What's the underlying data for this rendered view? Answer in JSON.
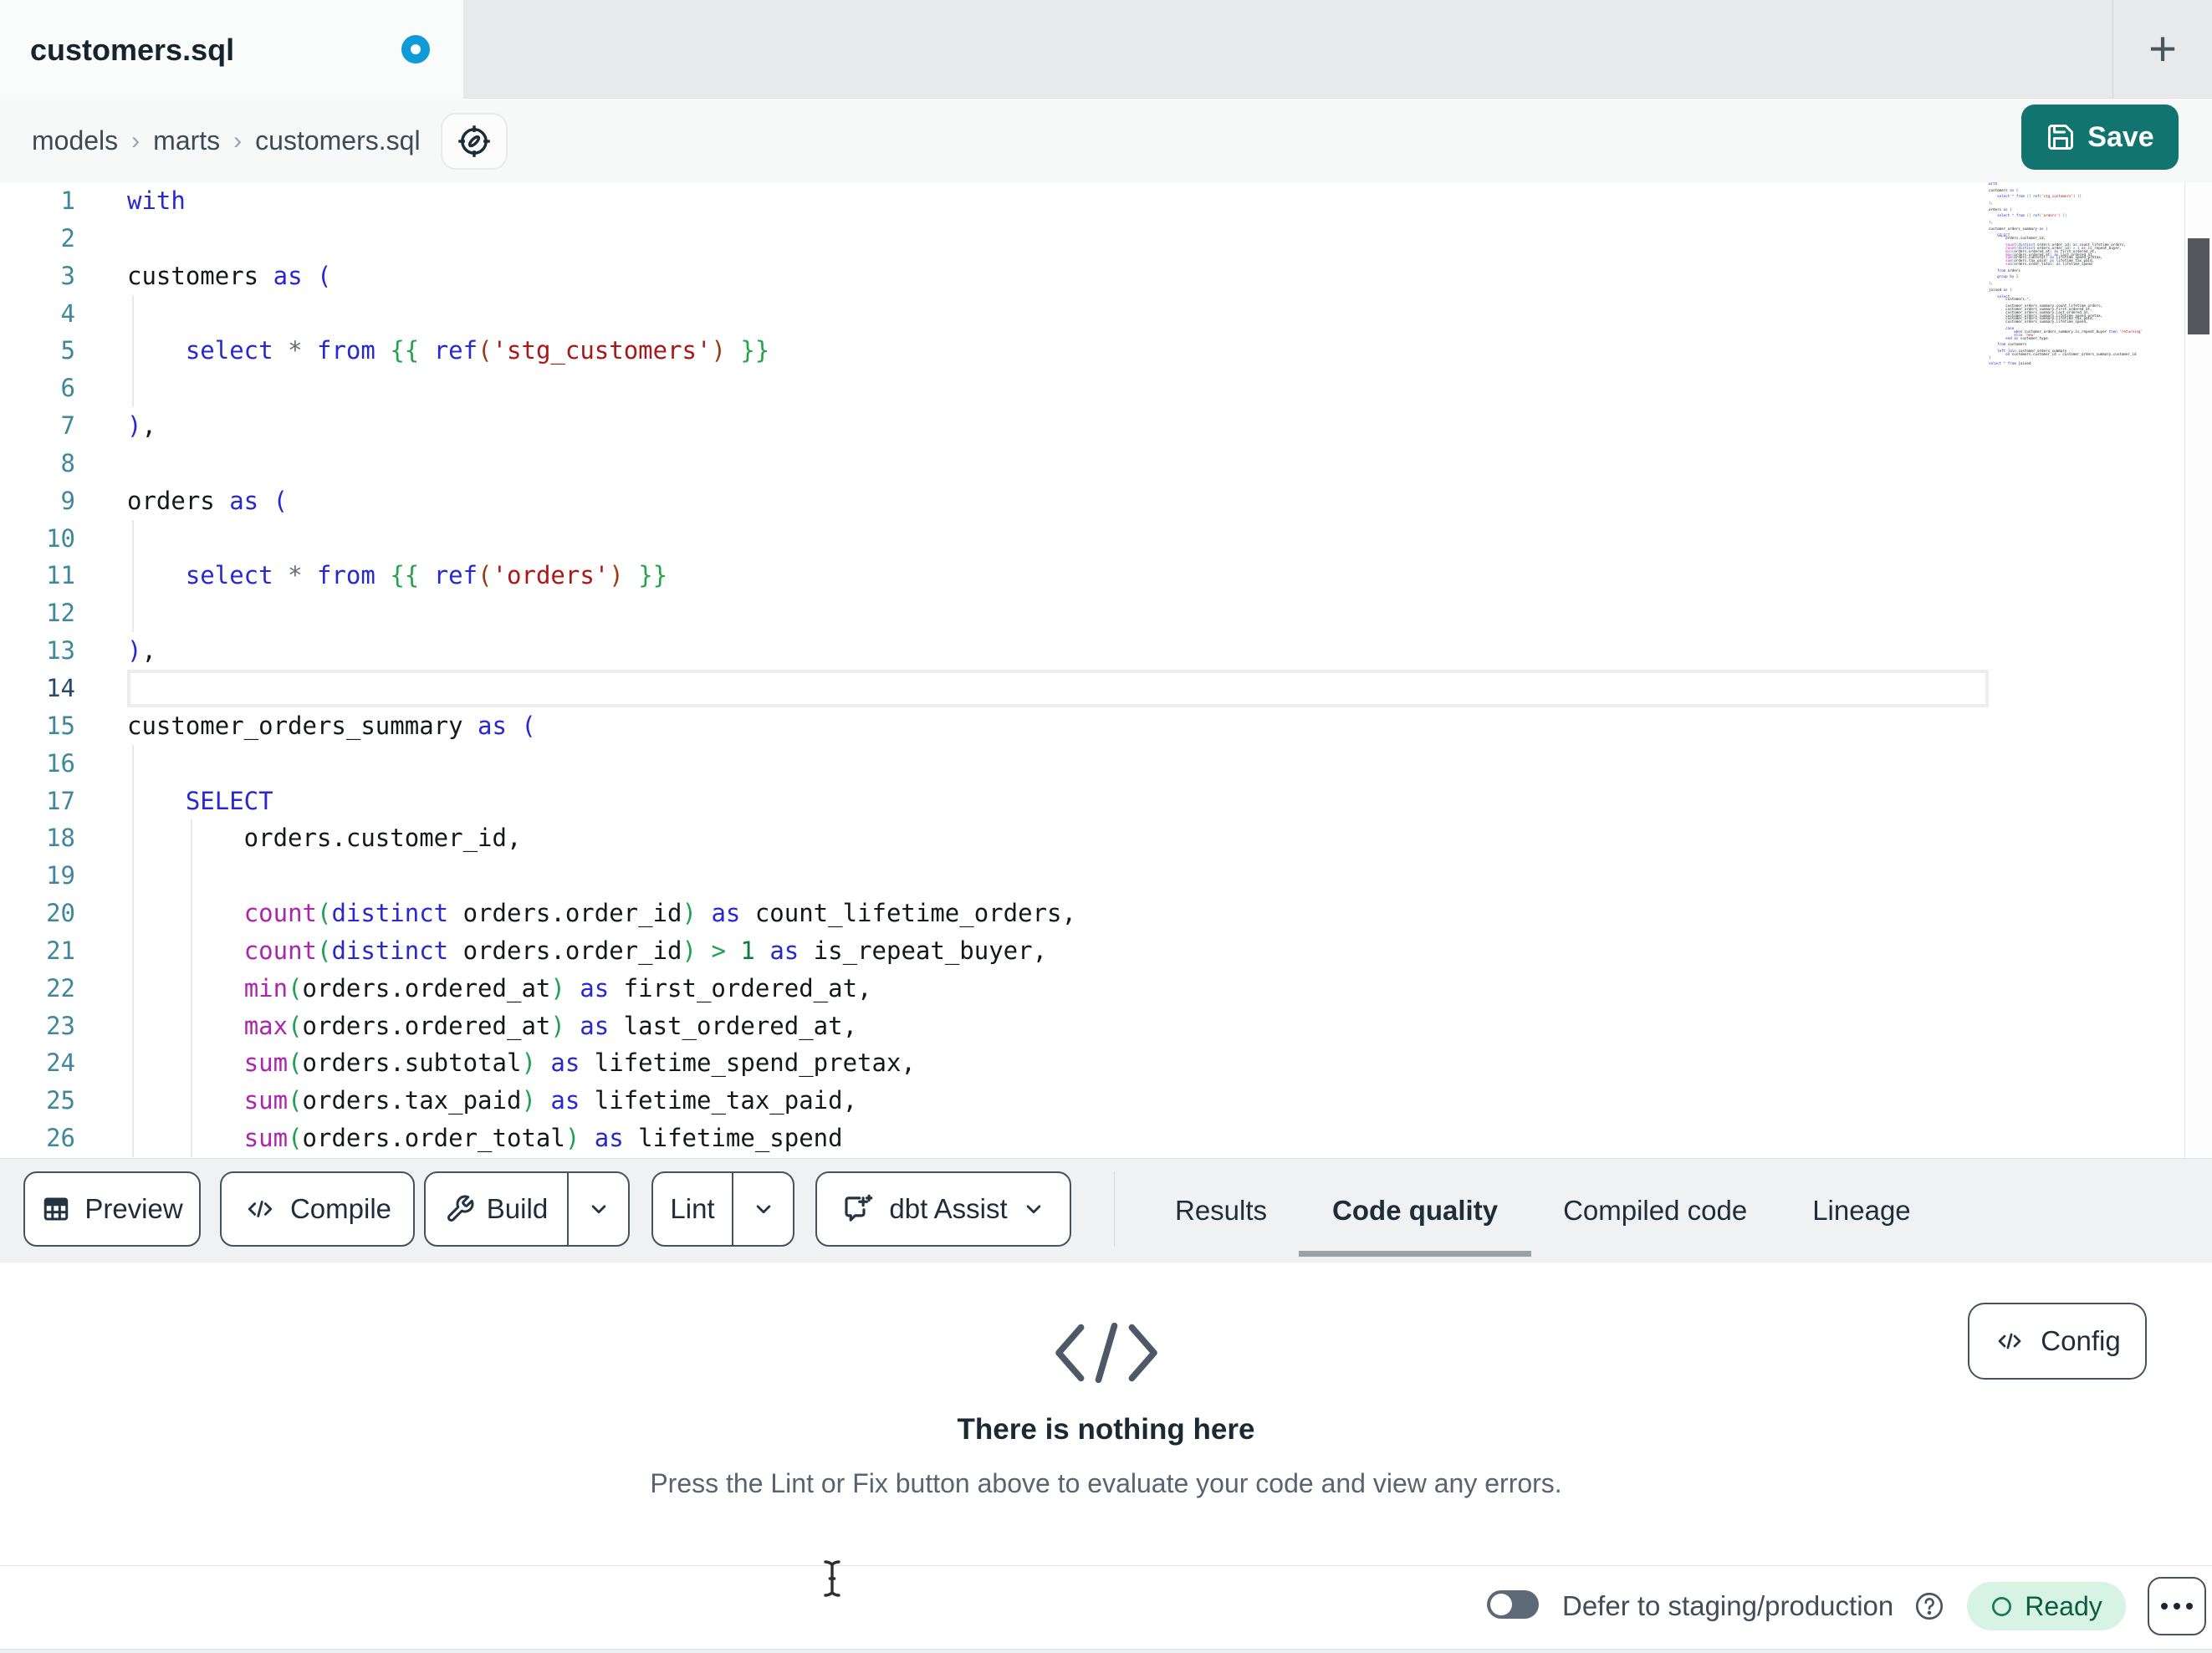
{
  "tab_bar": {
    "title": "customers.sql",
    "unsaved": true,
    "new_tab_glyph": "+"
  },
  "breadcrumb": {
    "items": [
      "models",
      "marts",
      "customers.sql"
    ],
    "separator": "›"
  },
  "save": {
    "label": "Save"
  },
  "toolbar": {
    "preview_label": "Preview",
    "compile_label": "Compile",
    "build_label": "Build",
    "lint_label": "Lint",
    "assist_label": "dbt Assist"
  },
  "panel_tabs": [
    {
      "label": "Results",
      "active": false
    },
    {
      "label": "Code quality",
      "active": true
    },
    {
      "label": "Compiled code",
      "active": false
    },
    {
      "label": "Lineage",
      "active": false
    }
  ],
  "results_panel": {
    "empty_title": "There is nothing here",
    "empty_subtitle": "Press the Lint or Fix button above to evaluate your code and view any errors.",
    "config_label": "Config"
  },
  "status_bar": {
    "defer_label": "Defer to staging/production",
    "toggle_on": false,
    "ready_label": "Ready"
  },
  "colors": {
    "save_teal": "#12746e",
    "unsaved_dot_blue": "#0f9bd5",
    "ready_bg": "#d6f3e3",
    "ready_text": "#0c5b42",
    "syntax": {
      "keyword": "#2828d2",
      "function": "#ad24ad",
      "paren": "#1fa053",
      "jinja": "#23a34a",
      "jinja_paren": "#9a3b12",
      "string": "#a91717",
      "number": "#0e7a35",
      "operator": "#5f6b76",
      "default": "#15181b",
      "line_number": "#3f879b",
      "active_line_number": "#27496b"
    }
  },
  "editor": {
    "language": "sql",
    "active_line": 14,
    "visible_lines": 26,
    "lines": [
      {
        "t": [
          [
            "k",
            "with"
          ]
        ]
      },
      {
        "t": []
      },
      {
        "t": [
          [
            "d",
            "customers "
          ],
          [
            "k",
            "as"
          ],
          [
            "d",
            " "
          ],
          [
            "k",
            "("
          ]
        ]
      },
      {
        "t": [],
        "g": [
          0
        ]
      },
      {
        "t": [
          [
            "d",
            "    "
          ],
          [
            "k",
            "select"
          ],
          [
            "d",
            " "
          ],
          [
            "o",
            "*"
          ],
          [
            "d",
            " "
          ],
          [
            "k",
            "from"
          ],
          [
            "d",
            " "
          ],
          [
            "j",
            "{{ "
          ],
          [
            "k",
            "ref"
          ],
          [
            "b",
            "("
          ],
          [
            "s",
            "'stg_customers'"
          ],
          [
            "b",
            ")"
          ],
          [
            "j",
            " }}"
          ]
        ],
        "g": [
          0
        ]
      },
      {
        "t": [],
        "g": [
          0
        ]
      },
      {
        "t": [
          [
            "k",
            ")"
          ],
          [
            "d",
            ","
          ]
        ]
      },
      {
        "t": []
      },
      {
        "t": [
          [
            "d",
            "orders "
          ],
          [
            "k",
            "as"
          ],
          [
            "d",
            " "
          ],
          [
            "k",
            "("
          ]
        ]
      },
      {
        "t": [],
        "g": [
          0
        ]
      },
      {
        "t": [
          [
            "d",
            "    "
          ],
          [
            "k",
            "select"
          ],
          [
            "d",
            " "
          ],
          [
            "o",
            "*"
          ],
          [
            "d",
            " "
          ],
          [
            "k",
            "from"
          ],
          [
            "d",
            " "
          ],
          [
            "j",
            "{{ "
          ],
          [
            "k",
            "ref"
          ],
          [
            "b",
            "("
          ],
          [
            "s",
            "'orders'"
          ],
          [
            "b",
            ")"
          ],
          [
            "j",
            " }}"
          ]
        ],
        "g": [
          0
        ]
      },
      {
        "t": [],
        "g": [
          0
        ]
      },
      {
        "t": [
          [
            "k",
            ")"
          ],
          [
            "d",
            ","
          ]
        ]
      },
      {
        "t": []
      },
      {
        "t": [
          [
            "d",
            "customer_orders_summary "
          ],
          [
            "k",
            "as"
          ],
          [
            "d",
            " "
          ],
          [
            "k",
            "("
          ]
        ]
      },
      {
        "t": [],
        "g": [
          0
        ]
      },
      {
        "t": [
          [
            "d",
            "    "
          ],
          [
            "k",
            "SELECT"
          ]
        ],
        "g": [
          0
        ]
      },
      {
        "t": [
          [
            "d",
            "        orders.customer_id,"
          ]
        ],
        "g": [
          0,
          1
        ]
      },
      {
        "t": [],
        "g": [
          0,
          1
        ]
      },
      {
        "t": [
          [
            "d",
            "        "
          ],
          [
            "f",
            "count"
          ],
          [
            "p",
            "("
          ],
          [
            "k",
            "distinct"
          ],
          [
            "d",
            " orders.order_id"
          ],
          [
            "p",
            ")"
          ],
          [
            "d",
            " "
          ],
          [
            "k",
            "as"
          ],
          [
            "d",
            " count_lifetime_orders,"
          ]
        ],
        "g": [
          0,
          1
        ]
      },
      {
        "t": [
          [
            "d",
            "        "
          ],
          [
            "f",
            "count"
          ],
          [
            "p",
            "("
          ],
          [
            "k",
            "distinct"
          ],
          [
            "d",
            " orders.order_id"
          ],
          [
            "p",
            ")"
          ],
          [
            "d",
            " "
          ],
          [
            "p",
            ">"
          ],
          [
            "d",
            " "
          ],
          [
            "n",
            "1"
          ],
          [
            "d",
            " "
          ],
          [
            "k",
            "as"
          ],
          [
            "d",
            " is_repeat_buyer,"
          ]
        ],
        "g": [
          0,
          1
        ]
      },
      {
        "t": [
          [
            "d",
            "        "
          ],
          [
            "f",
            "min"
          ],
          [
            "p",
            "("
          ],
          [
            "d",
            "orders.ordered_at"
          ],
          [
            "p",
            ")"
          ],
          [
            "d",
            " "
          ],
          [
            "k",
            "as"
          ],
          [
            "d",
            " first_ordered_at,"
          ]
        ],
        "g": [
          0,
          1
        ]
      },
      {
        "t": [
          [
            "d",
            "        "
          ],
          [
            "f",
            "max"
          ],
          [
            "p",
            "("
          ],
          [
            "d",
            "orders.ordered_at"
          ],
          [
            "p",
            ")"
          ],
          [
            "d",
            " "
          ],
          [
            "k",
            "as"
          ],
          [
            "d",
            " last_ordered_at,"
          ]
        ],
        "g": [
          0,
          1
        ]
      },
      {
        "t": [
          [
            "d",
            "        "
          ],
          [
            "f",
            "sum"
          ],
          [
            "p",
            "("
          ],
          [
            "d",
            "orders.subtotal"
          ],
          [
            "p",
            ")"
          ],
          [
            "d",
            " "
          ],
          [
            "k",
            "as"
          ],
          [
            "d",
            " lifetime_spend_pretax,"
          ]
        ],
        "g": [
          0,
          1
        ]
      },
      {
        "t": [
          [
            "d",
            "        "
          ],
          [
            "f",
            "sum"
          ],
          [
            "p",
            "("
          ],
          [
            "d",
            "orders.tax_paid"
          ],
          [
            "p",
            ")"
          ],
          [
            "d",
            " "
          ],
          [
            "k",
            "as"
          ],
          [
            "d",
            " lifetime_tax_paid,"
          ]
        ],
        "g": [
          0,
          1
        ]
      },
      {
        "t": [
          [
            "d",
            "        "
          ],
          [
            "f",
            "sum"
          ],
          [
            "p",
            "("
          ],
          [
            "d",
            "orders.order_total"
          ],
          [
            "p",
            ")"
          ],
          [
            "d",
            " "
          ],
          [
            "k",
            "as"
          ],
          [
            "d",
            " lifetime_spend"
          ]
        ],
        "g": [
          0,
          1
        ]
      },
      {
        "t": []
      },
      {
        "t": [
          [
            "d",
            "    "
          ],
          [
            "k",
            "from"
          ],
          [
            "d",
            " orders"
          ]
        ]
      },
      {
        "t": []
      },
      {
        "t": [
          [
            "d",
            "    "
          ],
          [
            "k",
            "group by"
          ],
          [
            "d",
            " "
          ],
          [
            "n",
            "1"
          ]
        ]
      },
      {
        "t": []
      },
      {
        "t": [
          [
            "k",
            ")"
          ],
          [
            "d",
            ","
          ]
        ]
      },
      {
        "t": []
      },
      {
        "t": [
          [
            "d",
            "joined "
          ],
          [
            "k",
            "as"
          ],
          [
            "d",
            " "
          ],
          [
            "k",
            "("
          ]
        ]
      },
      {
        "t": []
      },
      {
        "t": [
          [
            "d",
            "    "
          ],
          [
            "k",
            "select"
          ]
        ]
      },
      {
        "t": [
          [
            "d",
            "        customers."
          ],
          [
            "o",
            "*"
          ],
          [
            "d",
            ","
          ]
        ]
      },
      {
        "t": []
      },
      {
        "t": [
          [
            "d",
            "        customer_orders_summary.count_lifetime_orders,"
          ]
        ]
      },
      {
        "t": [
          [
            "d",
            "        customer_orders_summary.first_ordered_at,"
          ]
        ]
      },
      {
        "t": [
          [
            "d",
            "        customer_orders_summary.last_ordered_at,"
          ]
        ]
      },
      {
        "t": [
          [
            "d",
            "        customer_orders_summary.lifetime_spend_pretax,"
          ]
        ]
      },
      {
        "t": [
          [
            "d",
            "        customer_orders_summary.lifetime_tax_paid,"
          ]
        ]
      },
      {
        "t": [
          [
            "d",
            "        customer_orders_summary.lifetime_spend,"
          ]
        ]
      },
      {
        "t": []
      },
      {
        "t": [
          [
            "d",
            "        "
          ],
          [
            "k",
            "case"
          ]
        ]
      },
      {
        "t": [
          [
            "d",
            "            "
          ],
          [
            "k",
            "when"
          ],
          [
            "d",
            " customer_orders_summary.is_repeat_buyer "
          ],
          [
            "k",
            "then"
          ],
          [
            "d",
            " "
          ],
          [
            "s",
            "'returning'"
          ]
        ]
      },
      {
        "t": [
          [
            "d",
            "            "
          ],
          [
            "k",
            "else"
          ],
          [
            "d",
            " "
          ],
          [
            "s",
            "'new'"
          ]
        ]
      },
      {
        "t": [
          [
            "d",
            "        "
          ],
          [
            "k",
            "end"
          ],
          [
            "d",
            " "
          ],
          [
            "k",
            "as"
          ],
          [
            "d",
            " customer_type"
          ]
        ]
      },
      {
        "t": []
      },
      {
        "t": [
          [
            "d",
            "    "
          ],
          [
            "k",
            "from"
          ],
          [
            "d",
            " customers"
          ]
        ]
      },
      {
        "t": []
      },
      {
        "t": [
          [
            "d",
            "    "
          ],
          [
            "k",
            "left join"
          ],
          [
            "d",
            " customer_orders_summary"
          ]
        ]
      },
      {
        "t": [
          [
            "d",
            "        "
          ],
          [
            "k",
            "on"
          ],
          [
            "d",
            " customers.customer_id "
          ],
          [
            "p",
            "="
          ],
          [
            "d",
            " customer_orders_summary.customer_id"
          ]
        ]
      },
      {
        "t": [
          [
            "k",
            ")"
          ]
        ]
      },
      {
        "t": []
      },
      {
        "t": [
          [
            "k",
            "select"
          ],
          [
            "d",
            " "
          ],
          [
            "o",
            "*"
          ],
          [
            "d",
            " "
          ],
          [
            "k",
            "from"
          ],
          [
            "d",
            " joined"
          ]
        ]
      }
    ]
  }
}
